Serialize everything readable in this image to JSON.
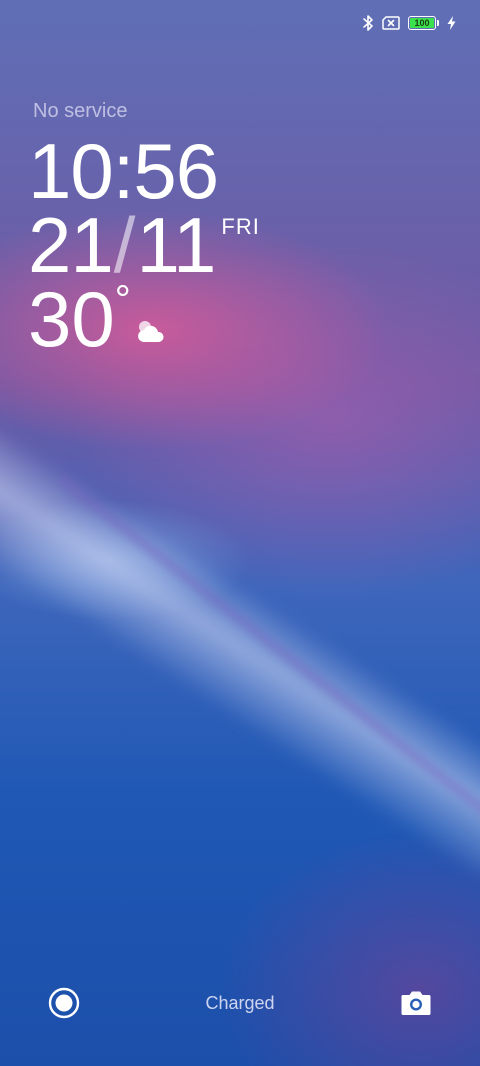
{
  "status_bar": {
    "bluetooth_icon": "bluetooth-icon",
    "sim_icon": "no-sim-icon",
    "battery": {
      "level": "100",
      "fill_percent": 100,
      "color": "#3be04d",
      "charging_icon": "bolt-icon"
    }
  },
  "lock_screen": {
    "carrier": "No service",
    "time": "10:56",
    "date": {
      "day": "21",
      "separator": "/",
      "month": "11",
      "weekday": "FRI"
    },
    "weather": {
      "temperature": "30",
      "unit": "°",
      "condition_icon": "partly-cloudy-icon"
    }
  },
  "bottom_bar": {
    "left_shortcut_icon": "record-icon",
    "status_text": "Charged",
    "right_shortcut_icon": "camera-icon"
  }
}
